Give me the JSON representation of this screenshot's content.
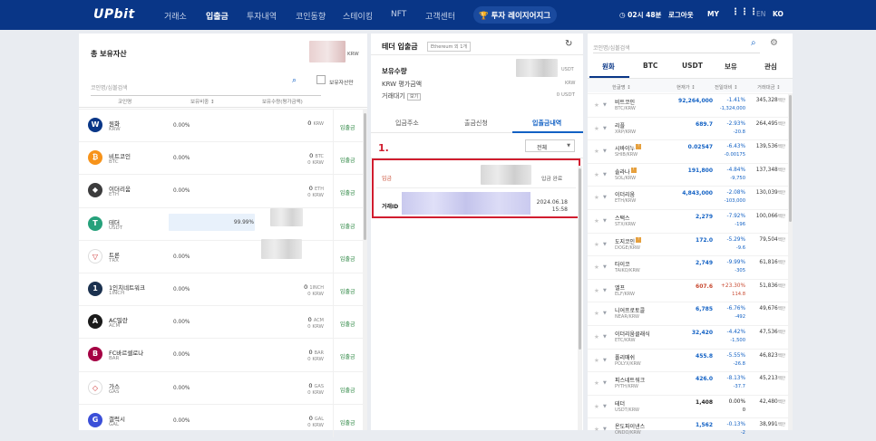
{
  "header": {
    "logo": "UPbit",
    "nav": [
      "거래소",
      "입출금",
      "투자내역",
      "코인동향",
      "스테이킹",
      "NFT",
      "고객센터"
    ],
    "invest_button": "투자 레이지어지그",
    "timer": "02시 48분",
    "logout": "로그아웃",
    "my": "MY",
    "lang_en": "EN",
    "lang_ko": "KO"
  },
  "holdings": {
    "title": "총 보유자산",
    "currency": "KRW",
    "search_placeholder": "코인명/심볼검색",
    "only_held_label": "보유자산만",
    "columns": [
      "코인명",
      "보유비중 ↕",
      "보유수량(평가금액)"
    ],
    "deposit_label": "입출금",
    "rows": [
      {
        "name": "원화",
        "symbol": "KRW",
        "share": "0.00%",
        "amount": "0",
        "unit": "KRW",
        "amount2": "",
        "color": "#093687",
        "glyph": "W"
      },
      {
        "name": "비트코인",
        "symbol": "BTC",
        "share": "0.00%",
        "amount": "0",
        "unit": "BTC",
        "amount2": "0 KRW",
        "color": "#f7931a",
        "glyph": "₿"
      },
      {
        "name": "이더리움",
        "symbol": "ETH",
        "share": "0.00%",
        "amount": "0",
        "unit": "ETH",
        "amount2": "0 KRW",
        "color": "#3c3c3d",
        "glyph": "◆"
      },
      {
        "name": "테더",
        "symbol": "USDT",
        "share": "99.99%",
        "amount": "",
        "unit": "",
        "amount2": "",
        "color": "#26a17b",
        "glyph": "T"
      },
      {
        "name": "트론",
        "symbol": "TRX",
        "share": "0.00%",
        "amount": "",
        "unit": "",
        "amount2": "",
        "color": "#ffffff",
        "glyph": "▽"
      },
      {
        "name": "1인치네트워크",
        "symbol": "1INCH",
        "share": "0.00%",
        "amount": "0",
        "unit": "1INCH",
        "amount2": "0 KRW",
        "color": "#1b314f",
        "glyph": "1"
      },
      {
        "name": "AC밀란",
        "symbol": "ACM",
        "share": "0.00%",
        "amount": "0",
        "unit": "ACM",
        "amount2": "0 KRW",
        "color": "#1a1a1a",
        "glyph": "A"
      },
      {
        "name": "FC바르셀로나",
        "symbol": "BAR",
        "share": "0.00%",
        "amount": "0",
        "unit": "BAR",
        "amount2": "0 KRW",
        "color": "#a50044",
        "glyph": "B"
      },
      {
        "name": "가스",
        "symbol": "GAS",
        "share": "0.00%",
        "amount": "0",
        "unit": "GAS",
        "amount2": "0 KRW",
        "color": "#ffffff",
        "glyph": "◇"
      },
      {
        "name": "갤럭시",
        "symbol": "GAL",
        "share": "0.00%",
        "amount": "0",
        "unit": "GAL",
        "amount2": "0 KRW",
        "color": "#3b4fd8",
        "glyph": "G"
      }
    ]
  },
  "transfer": {
    "title": "테더 입출금",
    "network_tag": "Ethereum 외 1개",
    "held_label": "보유수량",
    "held_unit": "USDT",
    "krw_label": "KRW 평가금액",
    "krw_unit": "KRW",
    "pending_label": "거래대기",
    "pending_view": "보기",
    "pending_value": "0 USDT",
    "tabs": [
      "입금주소",
      "출금신청",
      "입출금내역"
    ],
    "annotation": "1.",
    "filter": "전체",
    "tx": {
      "type": "입금",
      "status": "입금 완료",
      "id_label": "거래ID",
      "date": "2024.06.18",
      "time": "15:58"
    }
  },
  "market": {
    "search_placeholder": "코인명/심볼검색",
    "tabs": [
      "원화",
      "BTC",
      "USDT",
      "보유",
      "관심"
    ],
    "columns": [
      "한글명 ↕",
      "현재가 ↕",
      "전일대비 ↕",
      "거래대금 ↕"
    ],
    "vol_unit": "백만",
    "rows": [
      {
        "name": "비트코인",
        "symbol": "BTC/KRW",
        "price": "92,264,000",
        "chg": "-1.41%",
        "chg2": "-1,324,000",
        "vol": "345,328",
        "dir": "dn",
        "warn": false
      },
      {
        "name": "리플",
        "symbol": "XRP/KRW",
        "price": "689.7",
        "chg": "-2.93%",
        "chg2": "-20.8",
        "vol": "264,495",
        "dir": "dn",
        "warn": false
      },
      {
        "name": "시바이누",
        "symbol": "SHIB/KRW",
        "price": "0.02547",
        "chg": "-6.43%",
        "chg2": "-0.00175",
        "vol": "139,536",
        "dir": "dn",
        "warn": true
      },
      {
        "name": "솔라나",
        "symbol": "SOL/KRW",
        "price": "191,800",
        "chg": "-4.84%",
        "chg2": "-9,750",
        "vol": "137,348",
        "dir": "dn",
        "warn": true
      },
      {
        "name": "이더리움",
        "symbol": "ETH/KRW",
        "price": "4,843,000",
        "chg": "-2.08%",
        "chg2": "-103,000",
        "vol": "130,039",
        "dir": "dn",
        "warn": false
      },
      {
        "name": "스택스",
        "symbol": "STX/KRW",
        "price": "2,279",
        "chg": "-7.92%",
        "chg2": "-196",
        "vol": "100,066",
        "dir": "dn",
        "warn": false
      },
      {
        "name": "도지코인",
        "symbol": "DOGE/KRW",
        "price": "172.0",
        "chg": "-5.29%",
        "chg2": "-9.6",
        "vol": "79,504",
        "dir": "dn",
        "warn": true
      },
      {
        "name": "타이코",
        "symbol": "TAIKO/KRW",
        "price": "2,749",
        "chg": "-9.99%",
        "chg2": "-305",
        "vol": "61,816",
        "dir": "dn",
        "warn": false
      },
      {
        "name": "엘프",
        "symbol": "ELF/KRW",
        "price": "607.6",
        "chg": "+23.30%",
        "chg2": "114.8",
        "vol": "51,836",
        "dir": "up",
        "warn": false
      },
      {
        "name": "니어프로토콜",
        "symbol": "NEAR/KRW",
        "price": "6,785",
        "chg": "-6.76%",
        "chg2": "-492",
        "vol": "49,676",
        "dir": "dn",
        "warn": false
      },
      {
        "name": "이더리움클래식",
        "symbol": "ETC/KRW",
        "price": "32,420",
        "chg": "-4.42%",
        "chg2": "-1,500",
        "vol": "47,536",
        "dir": "dn",
        "warn": false
      },
      {
        "name": "폴리매쉬",
        "symbol": "POLYX/KRW",
        "price": "455.8",
        "chg": "-5.55%",
        "chg2": "-26.8",
        "vol": "46,823",
        "dir": "dn",
        "warn": false
      },
      {
        "name": "피스네트워크",
        "symbol": "PYTH/KRW",
        "price": "426.0",
        "chg": "-8.13%",
        "chg2": "-37.7",
        "vol": "45,213",
        "dir": "dn",
        "warn": false
      },
      {
        "name": "테더",
        "symbol": "USDT/KRW",
        "price": "1,408",
        "chg": "0.00%",
        "chg2": "0",
        "vol": "42,480",
        "dir": "eq",
        "warn": false
      },
      {
        "name": "온도파이낸스",
        "symbol": "ONDO/KRW",
        "price": "1,562",
        "chg": "-0.13%",
        "chg2": "-2",
        "vol": "38,991",
        "dir": "dn",
        "warn": false
      }
    ]
  }
}
